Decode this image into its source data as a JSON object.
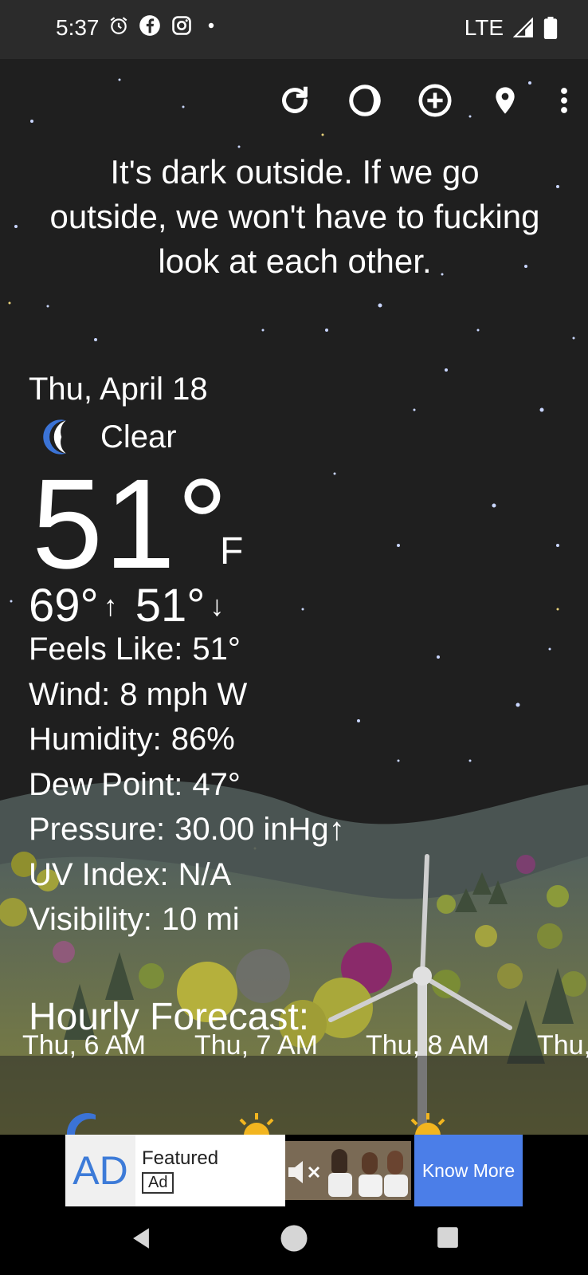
{
  "status_bar": {
    "time": "5:37",
    "network": "LTE"
  },
  "quote": "It's dark outside. If we go outside, we won't have to fucking look at each other.",
  "current": {
    "date": "Thu, April 18",
    "condition": "Clear",
    "temp": "51°",
    "unit": "F",
    "high": "69°",
    "low": "51°",
    "high_arrow": "↑",
    "low_arrow": "↓"
  },
  "details": [
    {
      "label": "Feels Like:",
      "value": "51°"
    },
    {
      "label": "Wind:",
      "value": "8 mph W"
    },
    {
      "label": "Humidity:",
      "value": "86%"
    },
    {
      "label": "Dew Point:",
      "value": "47°"
    },
    {
      "label": "Pressure:",
      "value": "30.00 inHg↑"
    },
    {
      "label": "UV Index:",
      "value": "N/A"
    },
    {
      "label": "Visibility:",
      "value": "10 mi"
    }
  ],
  "hourly": {
    "title": "Hourly Forecast:",
    "hours": [
      "Thu, 6 AM",
      "Thu, 7 AM",
      "Thu, 8 AM",
      "Thu,"
    ]
  },
  "ad": {
    "logo": "AD",
    "featured": "Featured",
    "tag": "Ad",
    "cta": "Know More"
  },
  "icons": {
    "refresh": "refresh-icon",
    "theme": "moon-phase-icon",
    "add": "add-location-icon",
    "location": "location-pin-icon",
    "more": "more-vert-icon"
  }
}
